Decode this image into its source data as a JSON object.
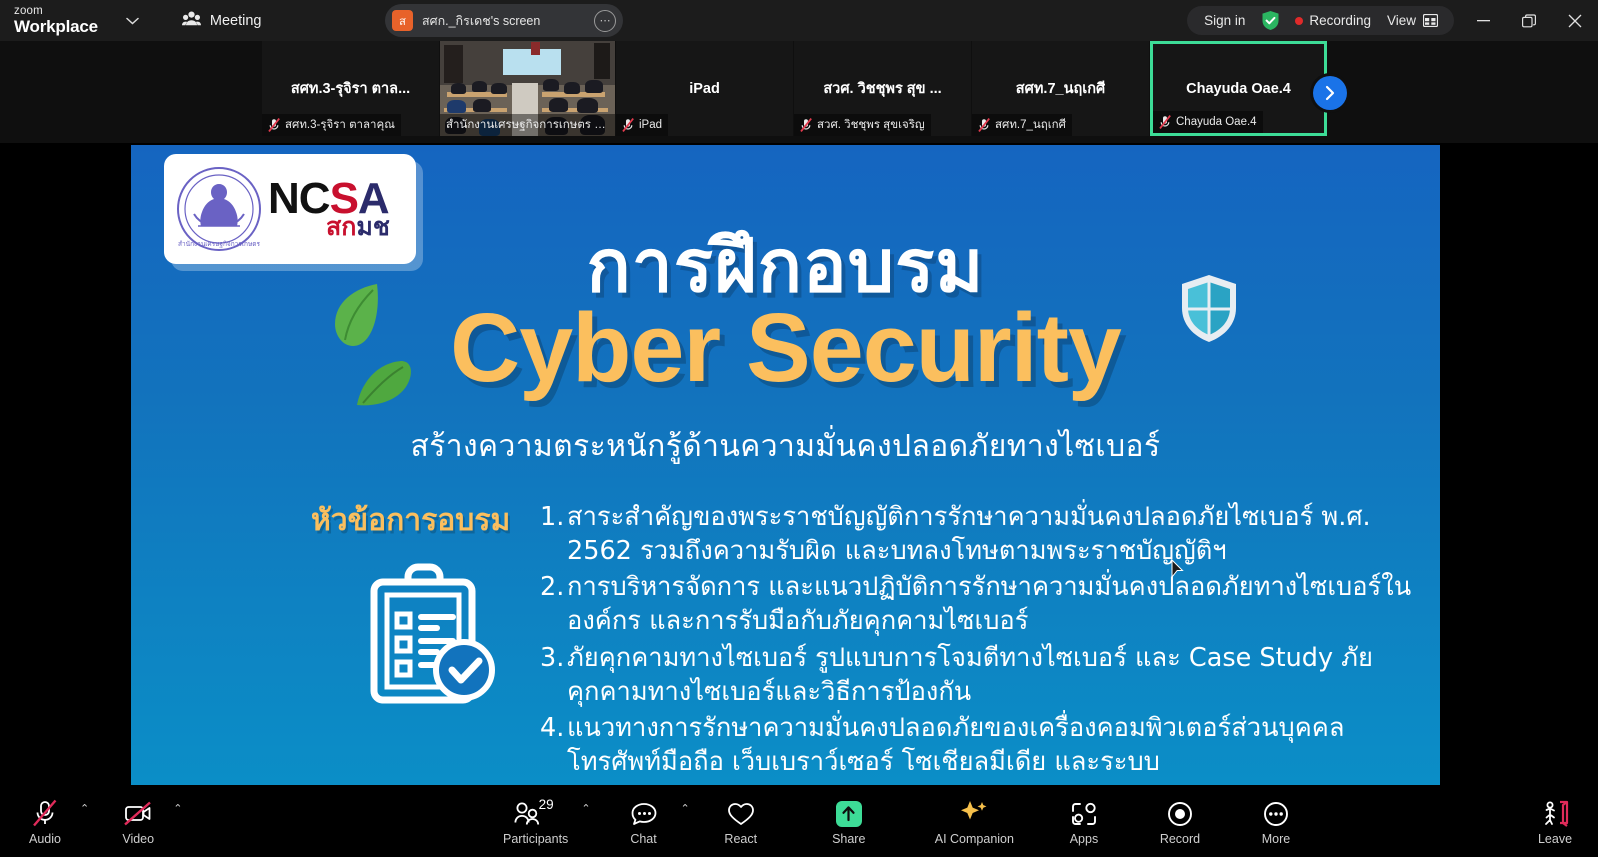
{
  "titlebar": {
    "brand_line1": "zoom",
    "brand_line2": "Workplace",
    "brand_caret": "chevron-down",
    "meeting_label": "Meeting",
    "share_tab": {
      "avatar_initial": "ส",
      "title": "สศก._กิรเดช's screen",
      "more": "⋯"
    },
    "sign_in": "Sign in",
    "recording_label": "Recording",
    "view_label": "View",
    "window_minimize": "—",
    "window_restore": "❐",
    "window_close": "✕"
  },
  "thumbnails": {
    "next_arrow": "›",
    "tiles": [
      {
        "display_name": "สศท.3-รุจิรา ตาล...",
        "nameplate": "สศท.3-รุจิรา ตาลาคุณ",
        "muted": true,
        "type": "name-only",
        "active": false
      },
      {
        "display_name": "",
        "nameplate": "สำนักงานเศรษฐกิจการเกษตร (ห้...",
        "muted": false,
        "type": "video",
        "active": false
      },
      {
        "display_name": "iPad",
        "nameplate": "iPad",
        "muted": true,
        "type": "name-only",
        "active": false
      },
      {
        "display_name": "สวศ. วิชชุพร สุข ...",
        "nameplate": "สวศ. วิชชุพร สุขเจริญ",
        "muted": true,
        "type": "name-only",
        "active": false
      },
      {
        "display_name": "สศท.7_นฤเกศี",
        "nameplate": "สศท.7_นฤเกศี",
        "muted": true,
        "type": "name-only",
        "active": false
      },
      {
        "display_name": "Chayuda Oae.4",
        "nameplate": "Chayuda Oae.4",
        "muted": true,
        "type": "name-only",
        "active": true
      }
    ]
  },
  "slide": {
    "logo": {
      "ncsa_n": "NC",
      "ncsa_s": "S",
      "ncsa_a": "A",
      "ncsa_thai_red": "สก",
      "ncsa_thai_dark": "มช"
    },
    "title_thai": "การฝึกอบรม",
    "title_english": "Cyber Security",
    "subtitle": "สร้างความตระหนักรู้ด้านความมั่นคงปลอดภัยทางไซเบอร์",
    "topics_heading": "หัวข้อการอบรม",
    "topics": [
      {
        "num": "1.",
        "text": "สาระสำคัญของพระราชบัญญัติการรักษาความมั่นคงปลอดภัยไซเบอร์ พ.ศ. 2562 รวมถึงความรับผิด และบทลงโทษตามพระราชบัญญัติฯ"
      },
      {
        "num": "2.",
        "text": "การบริหารจัดการ และแนวปฏิบัติการรักษาความมั่นคงปลอดภัยทางไซเบอร์ในองค์กร และการรับมือกับภัยคุกคามไซเบอร์"
      },
      {
        "num": "3.",
        "text": "ภัยคุกคามทางไซเบอร์ รูปแบบการโจมตีทางไซเบอร์ และ Case Study ภัยคุกคามทางไซเบอร์และวิธีการป้องกัน"
      },
      {
        "num": "4.",
        "text": "แนวทางการรักษาความมั่นคงปลอดภัยของเครื่องคอมพิวเตอร์ส่วนบุคคล โทรศัพท์มือถือ เว็บเบราว์เซอร์ โซเชียลมีเดีย และระบบ"
      }
    ]
  },
  "toolbar": {
    "audio": {
      "label": "Audio",
      "muted": true
    },
    "video": {
      "label": "Video",
      "muted": true
    },
    "participants": {
      "label": "Participants",
      "count": "29"
    },
    "chat": {
      "label": "Chat"
    },
    "react": {
      "label": "React"
    },
    "share": {
      "label": "Share"
    },
    "ai_companion": {
      "label": "AI Companion"
    },
    "apps": {
      "label": "Apps"
    },
    "record": {
      "label": "Record"
    },
    "more": {
      "label": "More"
    },
    "leave": {
      "label": "Leave"
    },
    "caret": "⌃"
  },
  "colors": {
    "accent_green": "#3ddc97",
    "recording_red": "#E02A2A",
    "slide_blue_top": "#1565C0",
    "slide_blue_bottom": "#0b8ec7",
    "title_amber": "#FBBF5E",
    "leave_red": "#E02B5A",
    "share_blue": "#1a73e8"
  }
}
